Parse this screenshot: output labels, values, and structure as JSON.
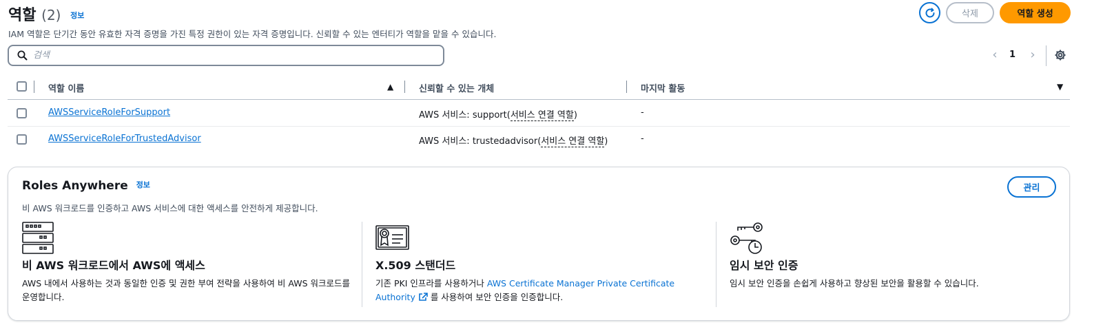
{
  "header": {
    "title": "역할",
    "count": "(2)",
    "info": "정보",
    "description": "IAM 역할은 단기간 동안 유효한 자격 증명을 가진 특정 권한이 있는 자격 증명입니다. 신뢰할 수 있는 엔터티가 역할을 맡을 수 있습니다.",
    "delete_label": "삭제",
    "create_label": "역할 생성"
  },
  "search": {
    "placeholder": "검색",
    "value": ""
  },
  "pagination": {
    "page": "1"
  },
  "table": {
    "columns": [
      "역할 이름",
      "신뢰할 수 있는 개체",
      "마지막 활동"
    ],
    "rows": [
      {
        "name": "AWSServiceRoleForSupport",
        "entity_prefix": "AWS 서비스: support",
        "entity_paren_open": "(",
        "entity_link": "서비스 연결 역할",
        "entity_paren_close": ")",
        "last": "-"
      },
      {
        "name": "AWSServiceRoleForTrustedAdvisor",
        "entity_prefix": "AWS 서비스: trustedadvisor",
        "entity_paren_open": "(",
        "entity_link": "서비스 연결 역할",
        "entity_paren_close": ")",
        "last": "-"
      }
    ]
  },
  "roles_anywhere": {
    "title": "Roles Anywhere",
    "info": "정보",
    "description": "비 AWS 워크로드를 인증하고 AWS 서비스에 대한 액세스를 안전하게 제공합니다.",
    "manage_label": "관리",
    "features": [
      {
        "icon": "server-rack-icon",
        "title": "비 AWS 워크로드에서 AWS에 액세스",
        "body": "AWS 내에서 사용하는 것과 동일한 인증 및 권한 부여 전략을 사용하여 비 AWS 워크로드를 운영합니다."
      },
      {
        "icon": "certificate-icon",
        "title": "X.509 스탠더드",
        "body_prefix": "기존 PKI 인프라를 사용하거나 ",
        "body_link": "AWS Certificate Manager Private Certificate Authority",
        "body_suffix": " 를 사용하여 보안 인증을 인증합니다."
      },
      {
        "icon": "keys-clock-icon",
        "title": "임시 보안 인증",
        "body": "임시 보안 인증을 손쉽게 사용하고 향상된 보안을 활용할 수 있습니다."
      }
    ]
  },
  "colors": {
    "accent": "#0972d3",
    "primary_button": "#ff9900",
    "border": "#7d8998"
  }
}
